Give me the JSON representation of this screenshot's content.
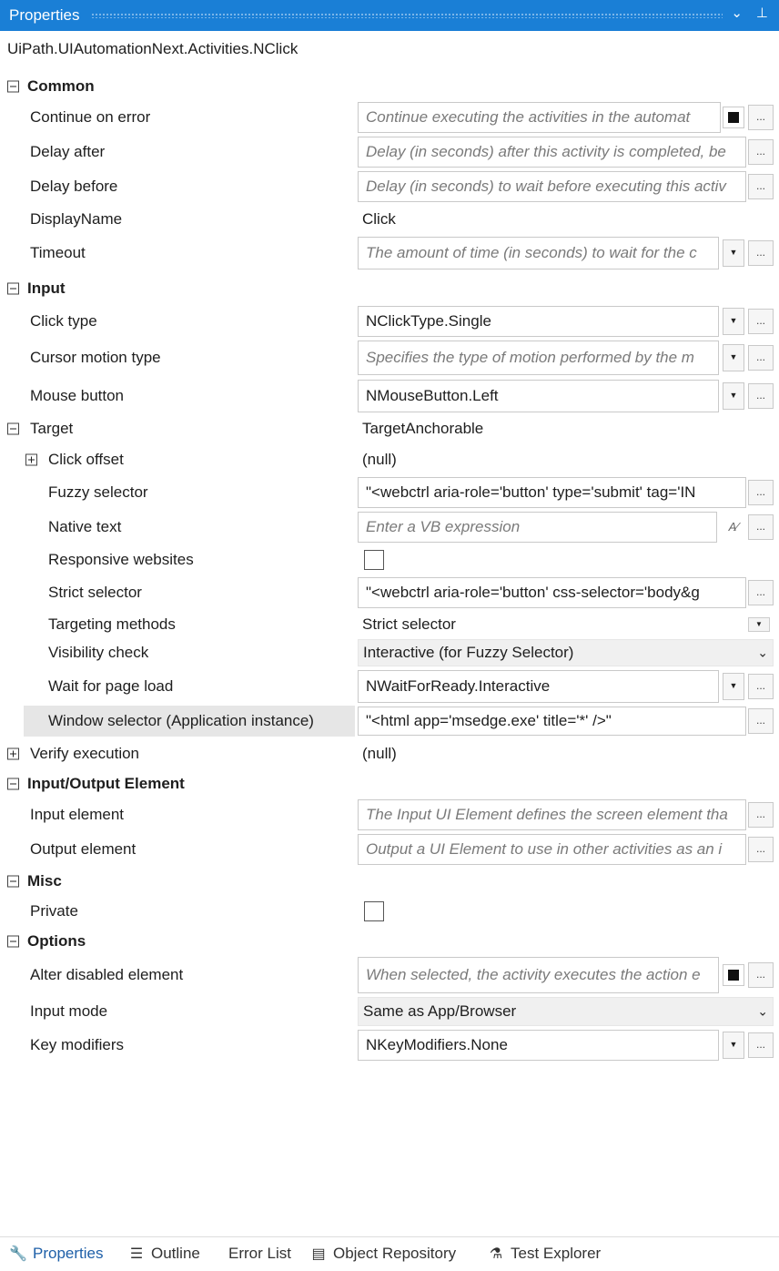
{
  "panel": {
    "title": "Properties",
    "menu_icon": "chevron-down",
    "pin_icon": "pin",
    "type_name": "UiPath.UIAutomationNext.Activities.NClick"
  },
  "categories": {
    "common": "Common",
    "input": "Input",
    "input_output": "Input/Output Element",
    "misc": "Misc",
    "options": "Options"
  },
  "rows": {
    "continue_on_error": {
      "label": "Continue on error",
      "placeholder": "Continue executing the activities in the automat"
    },
    "delay_after": {
      "label": "Delay after",
      "placeholder": "Delay (in seconds) after this activity is completed, be"
    },
    "delay_before": {
      "label": "Delay before",
      "placeholder": "Delay (in seconds) to wait before executing this activ"
    },
    "display_name": {
      "label": "DisplayName",
      "value": "Click"
    },
    "timeout": {
      "label": "Timeout",
      "placeholder": "The amount of time (in seconds) to wait for the c"
    },
    "click_type": {
      "label": "Click type",
      "value": "NClickType.Single"
    },
    "cursor_motion_type": {
      "label": "Cursor motion type",
      "placeholder": "Specifies the type of motion performed by the m"
    },
    "mouse_button": {
      "label": "Mouse button",
      "value": "NMouseButton.Left"
    },
    "target": {
      "label": "Target",
      "value": "TargetAnchorable"
    },
    "click_offset": {
      "label": "Click offset",
      "value": "(null)"
    },
    "fuzzy_selector": {
      "label": "Fuzzy selector",
      "value": "\"<webctrl aria-role='button' type='submit' tag='IN"
    },
    "native_text": {
      "label": "Native text",
      "placeholder": "Enter a VB expression",
      "expr_icon": "A⁄"
    },
    "responsive_websites": {
      "label": "Responsive websites",
      "checked": false
    },
    "strict_selector": {
      "label": "Strict selector",
      "value": "\"<webctrl aria-role='button' css-selector='body&g"
    },
    "targeting_methods": {
      "label": "Targeting methods",
      "value": "Strict selector"
    },
    "visibility_check": {
      "label": "Visibility check",
      "value": "Interactive (for Fuzzy Selector)"
    },
    "wait_for_page_load": {
      "label": "Wait for page load",
      "value": "NWaitForReady.Interactive"
    },
    "window_selector": {
      "label": "Window selector (Application instance)",
      "value": "\"<html app='msedge.exe' title='*' />\""
    },
    "verify_execution": {
      "label": "Verify execution",
      "value": "(null)"
    },
    "input_element": {
      "label": "Input element",
      "placeholder": "The Input UI Element defines the screen element tha"
    },
    "output_element": {
      "label": "Output element",
      "placeholder": "Output a UI Element to use in other activities as an i"
    },
    "private": {
      "label": "Private",
      "checked": false
    },
    "alter_disabled_element": {
      "label": "Alter disabled element",
      "placeholder": "When selected, the activity executes the action e"
    },
    "input_mode": {
      "label": "Input mode",
      "value": "Same as App/Browser"
    },
    "key_modifiers": {
      "label": "Key modifiers",
      "value": "NKeyModifiers.None"
    }
  },
  "buttons": {
    "ellipsis": "...",
    "dropdown": "▼",
    "chevron": "⌄"
  },
  "bottom_tabs": [
    {
      "label": "Properties",
      "icon": "wrench-icon",
      "active": true
    },
    {
      "label": "Outline",
      "icon": "outline-icon",
      "active": false
    },
    {
      "label": "Error List",
      "icon": "",
      "active": false
    },
    {
      "label": "Object Repository",
      "icon": "repository-icon",
      "active": false
    },
    {
      "label": "Test Explorer",
      "icon": "flask-icon",
      "active": false
    }
  ],
  "colors": {
    "title_bar": "#1a7fd6",
    "active_tab": "#1e5fa8",
    "placeholder_text": "#7a7a7a"
  }
}
